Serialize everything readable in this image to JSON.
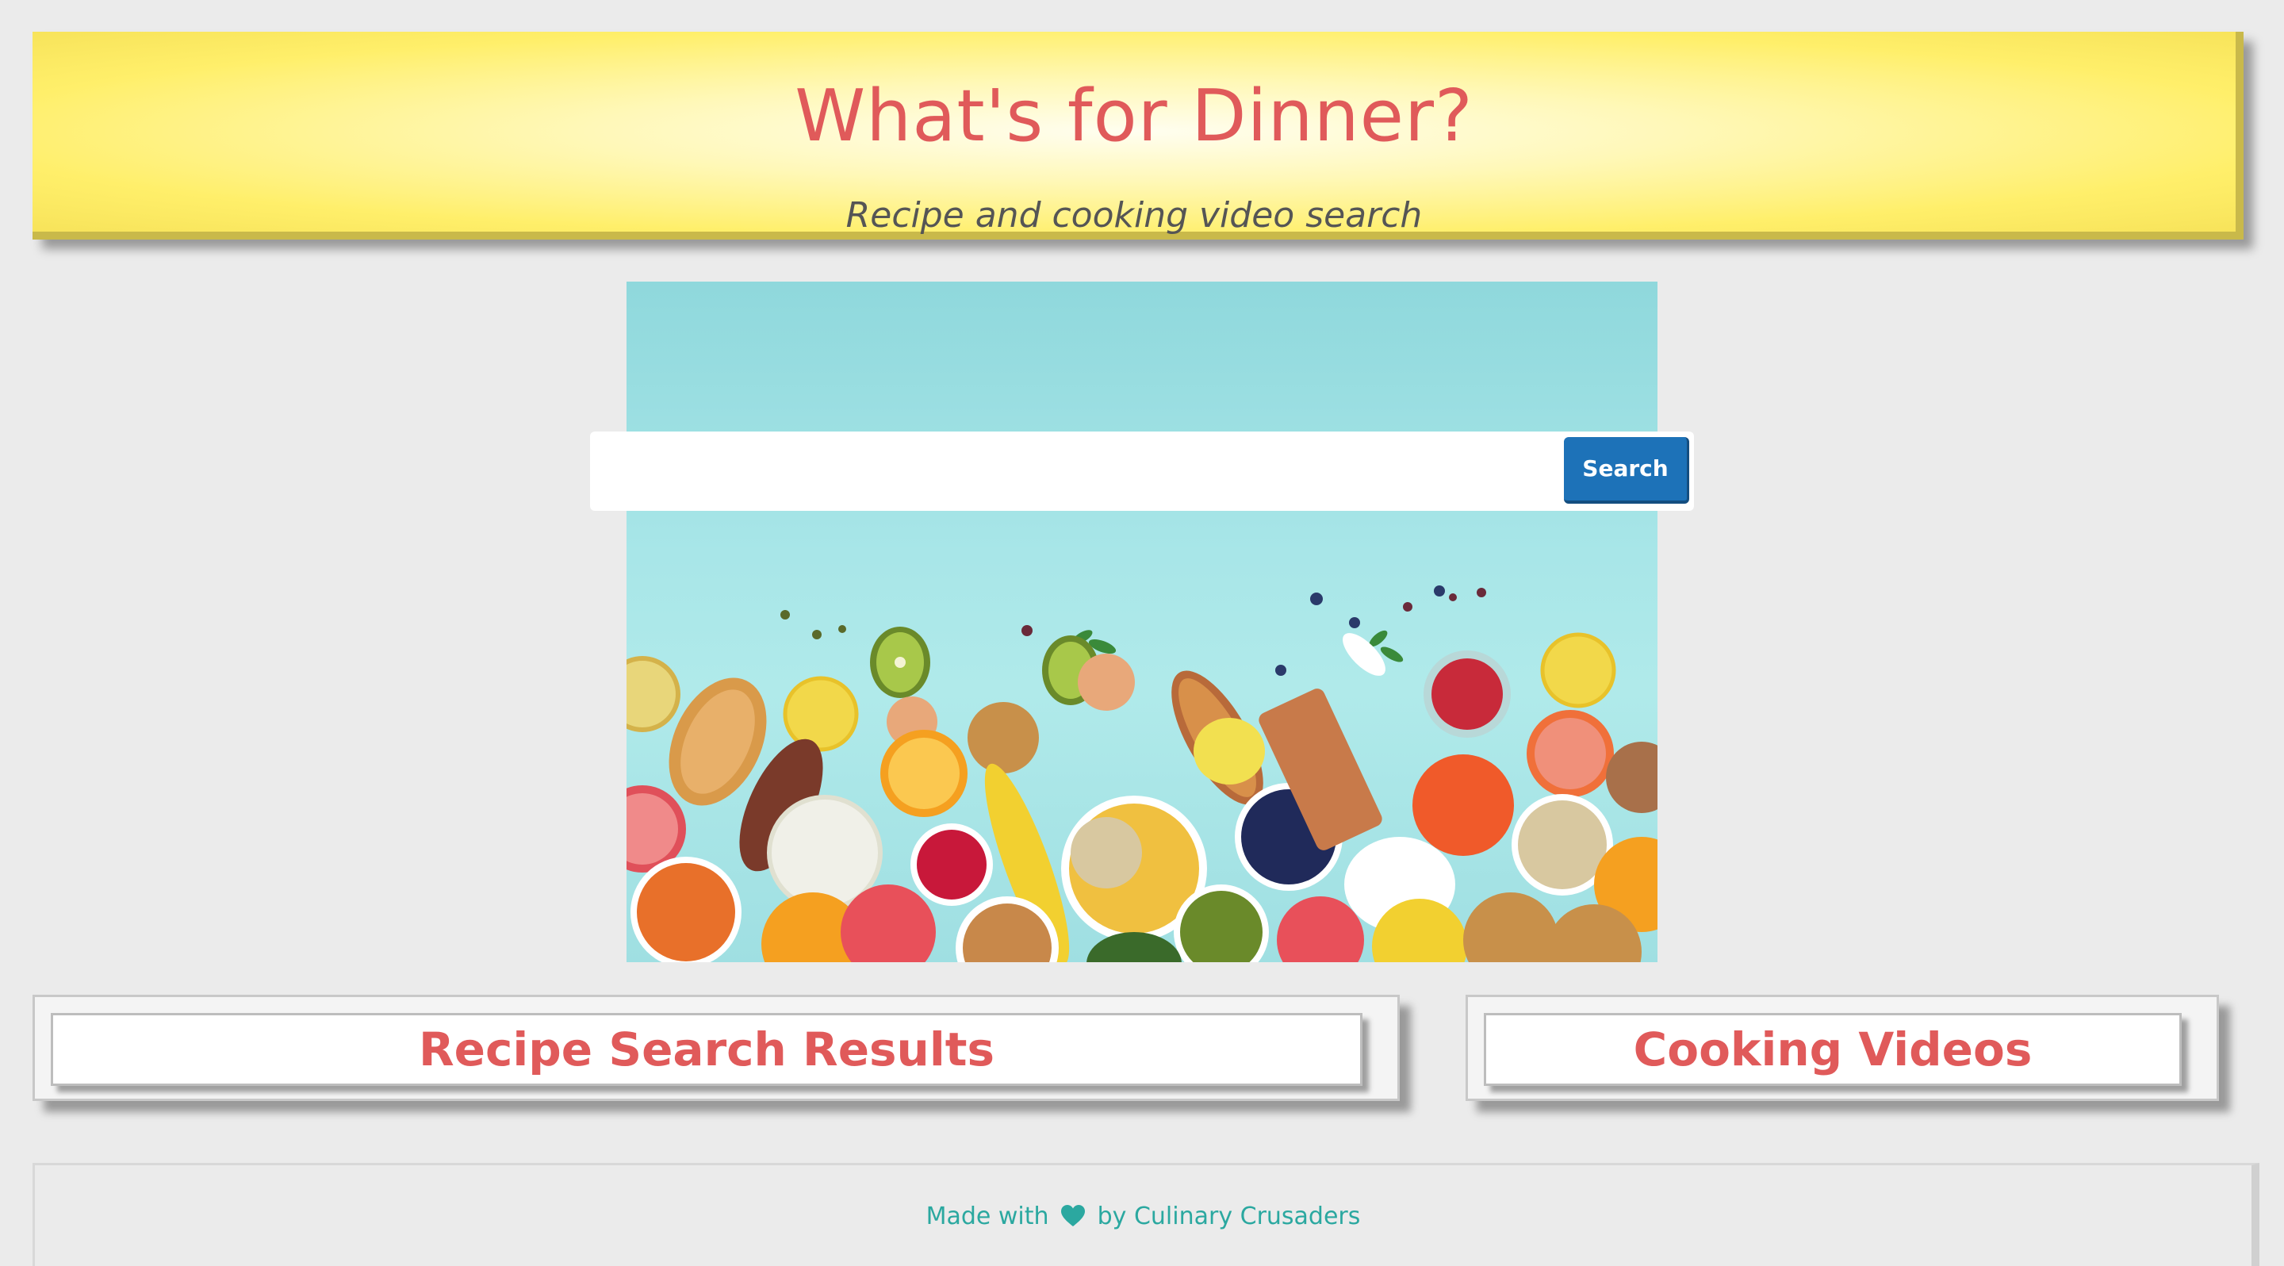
{
  "header": {
    "title": "What's for Dinner?",
    "subtitle": "Recipe and cooking video search"
  },
  "search": {
    "placeholder": "",
    "value": "",
    "button_label": "Search"
  },
  "panels": {
    "recipes_title": "Recipe Search Results",
    "videos_title": "Cooking Videos"
  },
  "footer": {
    "made_with": "Made with",
    "icon": "heart-icon",
    "by_text": "by Culinary Crusaders"
  },
  "colors": {
    "title_red": "#e05a5a",
    "header_yellow": "#ffef6a",
    "button_blue": "#1d72b8",
    "footer_teal": "#2ba8a0",
    "page_bg": "#ebebeb"
  }
}
